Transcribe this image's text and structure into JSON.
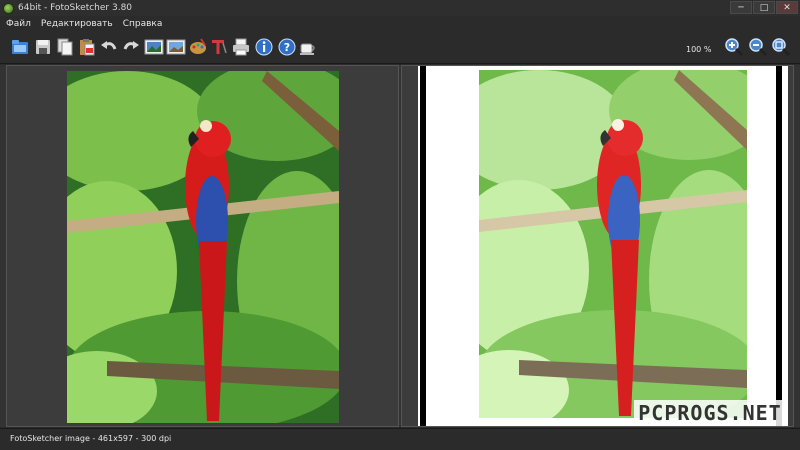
{
  "window": {
    "title": "64bit - FotoSketcher 3.80",
    "minimize": "─",
    "maximize": "□",
    "close": "✕"
  },
  "menu": {
    "items": [
      "Файл",
      "Редактировать",
      "Справка"
    ]
  },
  "toolbar": {
    "zoom_percent": "100 %",
    "icons": [
      "open-folder-icon",
      "save-icon",
      "copy-icon",
      "paste-icon",
      "undo-icon",
      "redo-icon",
      "image-before-icon",
      "image-after-icon",
      "palette-icon",
      "text-icon",
      "print-icon",
      "info-icon",
      "help-icon",
      "coffee-icon",
      "zoom-in-icon",
      "zoom-out-icon",
      "zoom-fit-icon"
    ]
  },
  "status": {
    "text": "FotoSketcher image - 461x597 - 300 dpi"
  },
  "watermark": {
    "text": "PCPROGS.NET"
  },
  "colors": {
    "background": "#2b2b2b",
    "pane": "#3c3c3c",
    "accent_blue": "#2f6fc4",
    "parrot_red": "#d41a1a",
    "foliage": "#3f8f2a"
  }
}
